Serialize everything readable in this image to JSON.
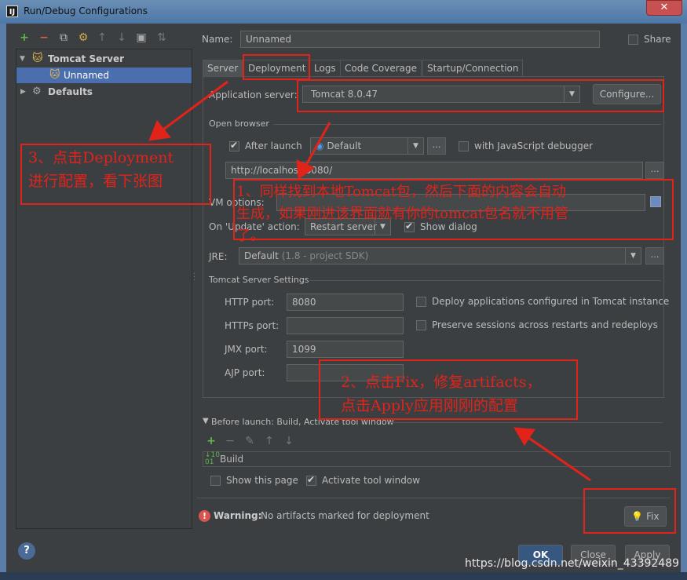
{
  "window": {
    "title": "Run/Debug Configurations",
    "close": "✕"
  },
  "left": {
    "toolbar": [
      "+",
      "−",
      "⧉",
      "⚙",
      "↑",
      "↓",
      "▣",
      "⇅"
    ],
    "tree": [
      {
        "label": "Tomcat Server"
      },
      {
        "label": "Unnamed"
      },
      {
        "label": "Defaults"
      }
    ]
  },
  "name_row": {
    "label": "Name:",
    "value": "Unnamed",
    "share_label": "Share"
  },
  "tabs": [
    "Server",
    "Deployment",
    "Logs",
    "Code Coverage",
    "Startup/Connection"
  ],
  "server": {
    "app_server_label": "Application server:",
    "app_server_value": "Tomcat 8.0.47",
    "configure_label": "Configure...",
    "open_browser_label": "Open browser",
    "after_launch_label": "After launch",
    "browser_value": "Default",
    "js_debugger_label": "with JavaScript debugger",
    "url_value": "http://localhost:8080/",
    "vm_options_label": "VM options:",
    "on_update_label": "On 'Update' action:",
    "on_update_value": "Restart server",
    "show_dialog_label": "Show dialog",
    "jre_label": "JRE:",
    "jre_value": "Default",
    "jre_hint": "(1.8 - project SDK)",
    "tomcat_settings_label": "Tomcat Server Settings",
    "http_port_label": "HTTP port:",
    "http_port_value": "8080",
    "https_port_label": "HTTPs port:",
    "https_port_value": "",
    "jmx_port_label": "JMX port:",
    "jmx_port_value": "1099",
    "ajp_port_label": "AJP port:",
    "ajp_port_value": "",
    "deploy_apps_label": "Deploy applications configured in Tomcat instance",
    "preserve_sessions_label": "Preserve sessions across restarts and redeploys"
  },
  "before_launch": {
    "header": "Before launch: Build, Activate tool window",
    "tools": [
      "+",
      "−",
      "✎",
      "↑",
      "↓"
    ],
    "item": "Build",
    "show_page_label": "Show this page",
    "activate_tool_label": "Activate tool window"
  },
  "warning": {
    "bold": "Warning:",
    "text": "No artifacts marked for deployment",
    "fix_label": "Fix"
  },
  "footer": {
    "help": "?",
    "ok": "OK",
    "close": "Close",
    "apply": "Apply"
  },
  "annotations": {
    "step3_line1": "3、点击Deployment",
    "step3_line2": "进行配置，看下张图",
    "step1_line1": "1、同样找到本地Tomcat包，然后下面的内容会自动",
    "step1_line2": "生成，如果刚进该界面就有你的tomcat包名就不用管",
    "step1_line3": "了。",
    "step2_line1": "2、点击Fix，修复artifacts，",
    "step2_line2": "点击Apply应用刚刚的配置"
  },
  "watermark": "https://blog.csdn.net/weixin_43392489",
  "colors": {
    "annotation": "#e2231a",
    "selection": "#4b6eaf",
    "background": "#3c3f41"
  }
}
